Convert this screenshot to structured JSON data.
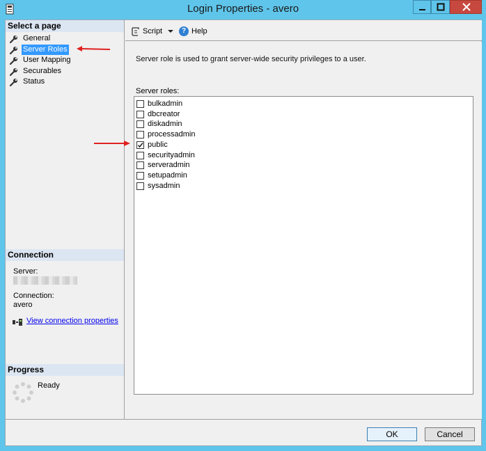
{
  "window": {
    "title": "Login Properties - avero"
  },
  "left_pane": {
    "select_page_heading": "Select a page",
    "pages": [
      {
        "label": "General",
        "selected": false
      },
      {
        "label": "Server Roles",
        "selected": true
      },
      {
        "label": "User Mapping",
        "selected": false
      },
      {
        "label": "Securables",
        "selected": false
      },
      {
        "label": "Status",
        "selected": false
      }
    ],
    "connection": {
      "heading": "Connection",
      "server_label": "Server:",
      "connection_label": "Connection:",
      "connection_value": "avero",
      "view_link": "View connection properties"
    },
    "progress": {
      "heading": "Progress",
      "status": "Ready"
    }
  },
  "toolbar": {
    "script_label": "Script",
    "help_label": "Help"
  },
  "main": {
    "description": "Server role is used to grant server-wide security privileges to a user.",
    "roles_label": "Server roles:",
    "roles": [
      {
        "name": "bulkadmin",
        "checked": false
      },
      {
        "name": "dbcreator",
        "checked": false
      },
      {
        "name": "diskadmin",
        "checked": false
      },
      {
        "name": "processadmin",
        "checked": false
      },
      {
        "name": "public",
        "checked": true
      },
      {
        "name": "securityadmin",
        "checked": false
      },
      {
        "name": "serveradmin",
        "checked": false
      },
      {
        "name": "setupadmin",
        "checked": false
      },
      {
        "name": "sysadmin",
        "checked": false
      }
    ]
  },
  "footer": {
    "ok_label": "OK",
    "cancel_label": "Cancel"
  },
  "colors": {
    "titlebar": "#5fc5ea",
    "selection": "#3399ff",
    "annotation_arrow": "#e02020"
  }
}
